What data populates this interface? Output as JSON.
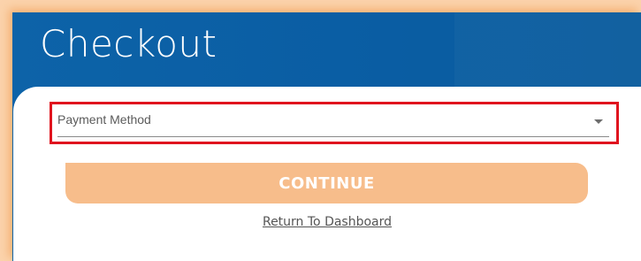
{
  "page": {
    "title": "Checkout"
  },
  "payment": {
    "select_label": "Payment Method"
  },
  "actions": {
    "continue_label": "CONTINUE",
    "return_link": "Return To Dashboard"
  },
  "colors": {
    "header_blue": "#0b5fa5",
    "continue_orange": "#f7bd8b",
    "highlight_red": "#e0141e"
  }
}
